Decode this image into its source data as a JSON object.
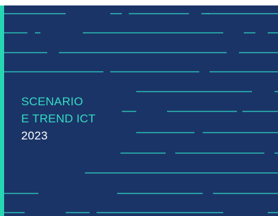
{
  "cover": {
    "title_line_1": "SCENARIO",
    "title_line_2": "E TREND ICT",
    "year": "2023"
  },
  "colors": {
    "background": "#1b3467",
    "accent": "#27d7b4",
    "title": "#33dcc4",
    "year": "#ffffff"
  }
}
